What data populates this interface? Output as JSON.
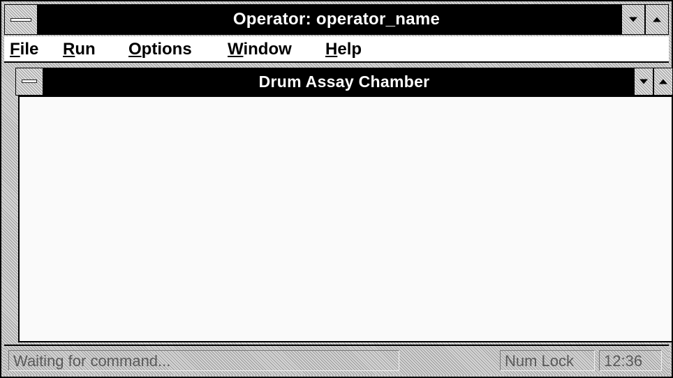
{
  "window": {
    "title": "Operator: operator_name"
  },
  "menu": {
    "items": [
      {
        "label": "File",
        "mnemonic": "F",
        "rest": "ile"
      },
      {
        "label": "Run",
        "mnemonic": "R",
        "rest": "un"
      },
      {
        "label": "Options",
        "mnemonic": "O",
        "rest": "ptions"
      },
      {
        "label": "Window",
        "mnemonic": "W",
        "rest": "indow"
      },
      {
        "label": "Help",
        "mnemonic": "H",
        "rest": "elp"
      }
    ]
  },
  "child_window": {
    "title": "Drum Assay Chamber"
  },
  "statusbar": {
    "message": "Waiting for command...",
    "num_lock": "Num Lock",
    "time": "12:36"
  },
  "icons": {
    "system_menu": "system-menu-icon",
    "minimize": "minimize-arrow-icon",
    "maximize": "maximize-arrow-icon"
  }
}
